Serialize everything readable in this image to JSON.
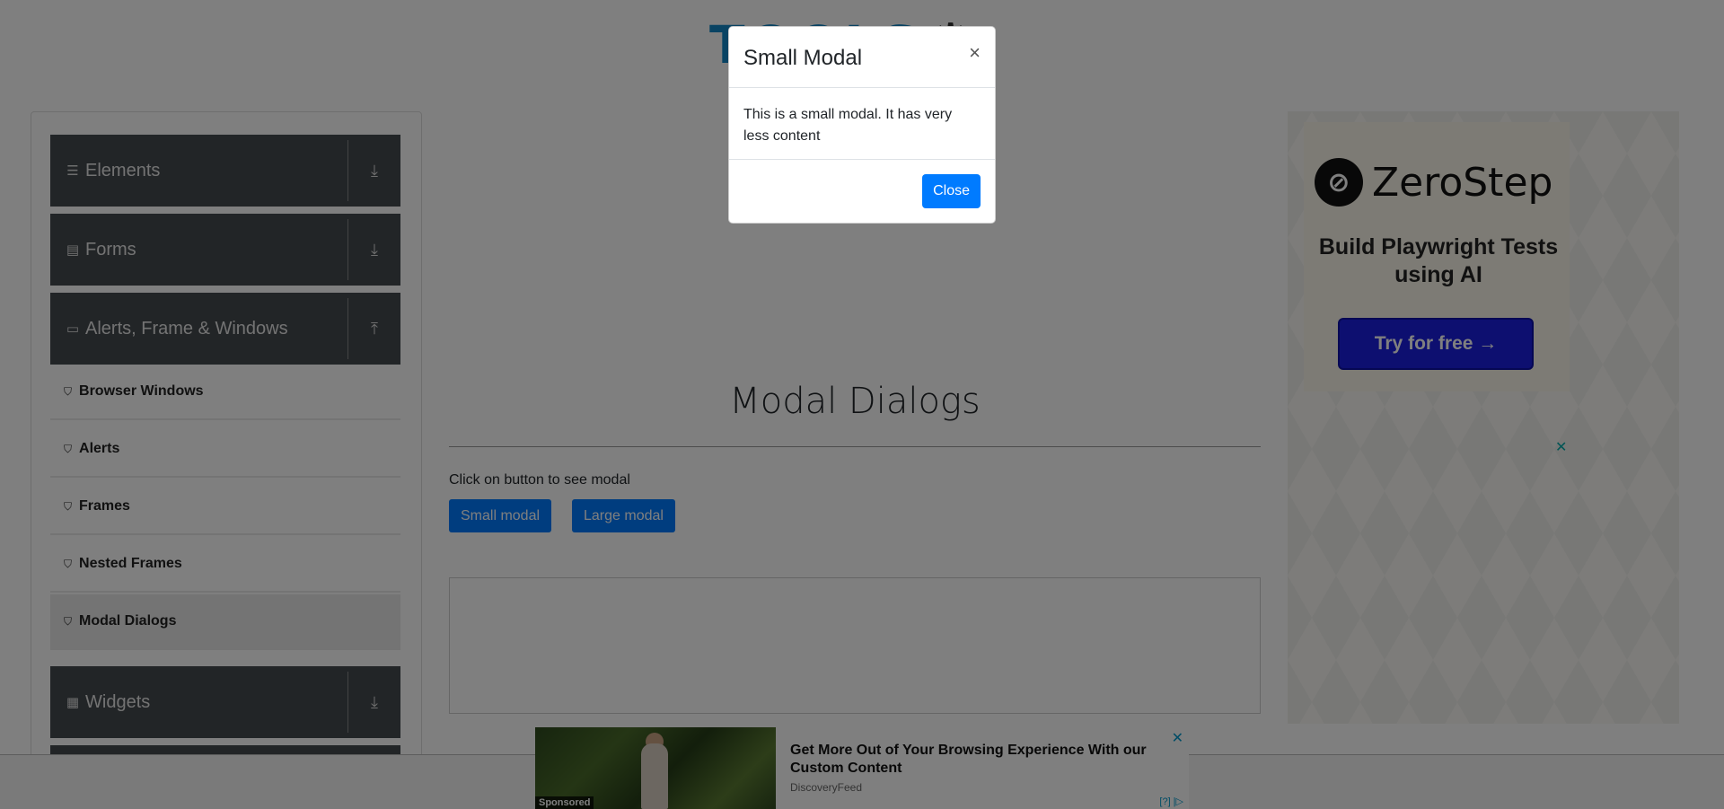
{
  "header": {
    "logo_text": "TOOLS"
  },
  "sidebar": {
    "groups": [
      {
        "label": "Elements",
        "icon": "menu-icon",
        "arrow": "download-icon"
      },
      {
        "label": "Forms",
        "icon": "document-icon",
        "arrow": "download-icon"
      },
      {
        "label": "Alerts, Frame & Windows",
        "icon": "window-icon",
        "arrow": "upload-icon"
      },
      {
        "label": "Widgets",
        "icon": "widgets-icon",
        "arrow": "download-icon"
      }
    ],
    "subitems": [
      {
        "label": "Browser Windows"
      },
      {
        "label": "Alerts"
      },
      {
        "label": "Frames"
      },
      {
        "label": "Nested Frames"
      },
      {
        "label": "Modal Dialogs"
      }
    ],
    "active_subitem": "Modal Dialogs"
  },
  "main": {
    "title": "Modal Dialogs",
    "hint": "Click on button to see modal",
    "small_modal_label": "Small modal",
    "large_modal_label": "Large modal"
  },
  "ad_right": {
    "brand": "ZeroStep",
    "headline": "Build Playwright Tests using AI",
    "cta": "Try for free →",
    "close": "✕"
  },
  "banner": {
    "headline": "Get More Out of Your Browsing Experience With our Custom Content",
    "source": "DiscoveryFeed",
    "sponsored": "Sponsored",
    "adchoice": "[?] |▷",
    "close": "✕"
  },
  "modal": {
    "title": "Small Modal",
    "close_x": "×",
    "body": "This is a small modal. It has very less content",
    "close_label": "Close"
  },
  "colors": {
    "primary": "#007bff",
    "sidebar_group": "#454a4f",
    "logo_blue": "#1287c6",
    "cta_blue": "#1a1ee0"
  }
}
